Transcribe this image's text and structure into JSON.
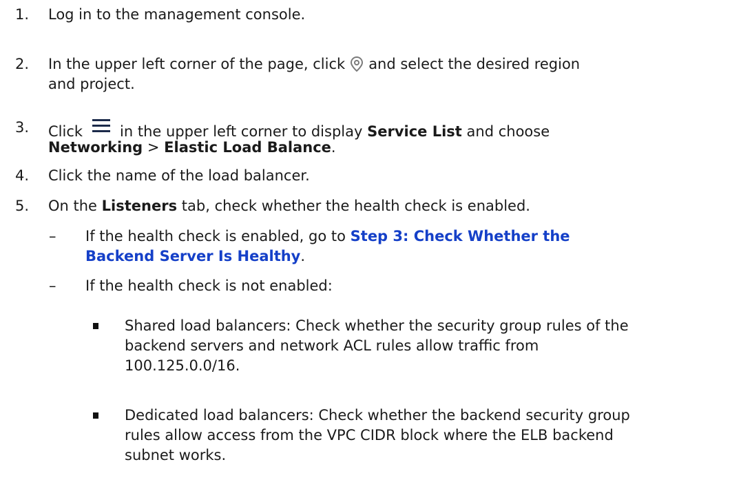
{
  "steps": [
    {
      "num": "1.",
      "text": "Log in to the management console."
    },
    {
      "num": "2.",
      "pre": "In the upper left corner of the page, click",
      "icon": "location-pin-icon",
      "post": "and select the desired region",
      "line2": "and project."
    },
    {
      "num": "3.",
      "pre": "Click",
      "icon": "menu-hamburger-icon",
      "mid": "in the upper left corner to display",
      "bold1": "Service List",
      "post": "and choose",
      "bold2": "Networking",
      "sep": ">",
      "bold3": "Elastic Load Balance",
      "end": "."
    },
    {
      "num": "4.",
      "text": "Click the name of the load balancer."
    },
    {
      "num": "5.",
      "pre": "On the",
      "bold": "Listeners",
      "post": "tab, check whether the health check is enabled."
    }
  ],
  "sub_items": [
    {
      "dash": "–",
      "pre": "If the health check is enabled, go to",
      "link_line1": "Step 3: Check Whether the",
      "link_line2": "Backend Server Is Healthy",
      "end": "."
    },
    {
      "dash": "–",
      "text": "If the health check is not enabled:"
    }
  ],
  "bullets": [
    {
      "line1": "Shared load balancers: Check whether the security group rules of the",
      "line2": "backend servers and network ACL rules allow traffic from",
      "line3": "100.125.0.0/16."
    },
    {
      "line1": "Dedicated load balancers: Check whether the backend security group",
      "line2": "rules allow access from the VPC CIDR block where the ELB backend",
      "line3": "subnet works."
    }
  ],
  "colors": {
    "link": "#1540c8",
    "icon_gray": "#7a7a7a",
    "icon_navy": "#1b2a4a"
  }
}
